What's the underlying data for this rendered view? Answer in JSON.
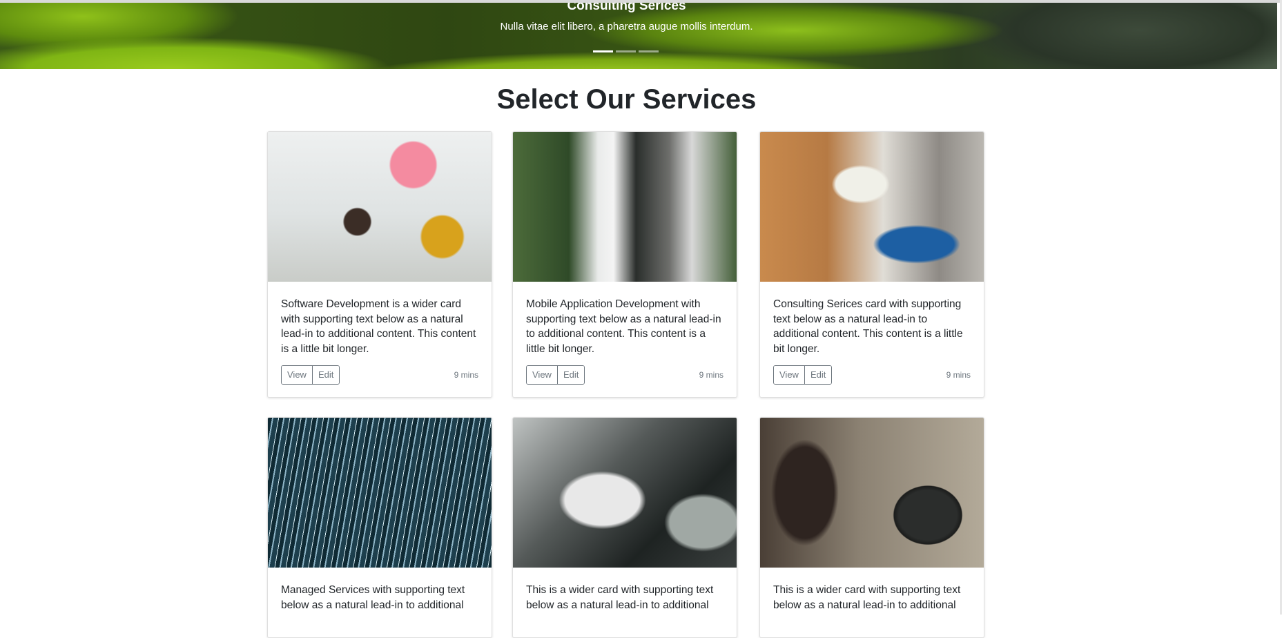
{
  "hero": {
    "title": "Consulting Serices",
    "subtitle": "Nulla vitae elit libero, a pharetra augue mollis interdum.",
    "slides": 3,
    "active_slide": 1
  },
  "heading": "Select Our Services",
  "cards": [
    {
      "text": "Software Development is a wider card with supporting text below as a natural lead-in to additional content. This content is a little bit longer.",
      "view": "View",
      "edit": "Edit",
      "time": "9 mins"
    },
    {
      "text": "Mobile Application Development with supporting text below as a natural lead-in to additional content. This content is a little bit longer.",
      "view": "View",
      "edit": "Edit",
      "time": "9 mins"
    },
    {
      "text": "Consulting Serices card with supporting text below as a natural lead-in to additional content. This content is a little bit longer.",
      "view": "View",
      "edit": "Edit",
      "time": "9 mins"
    },
    {
      "text": "Managed Services with supporting text below as a natural lead-in to additional"
    },
    {
      "text": "This is a wider card with supporting text below as a natural lead-in to additional"
    },
    {
      "text": "This is a wider card with supporting text below as a natural lead-in to additional"
    }
  ]
}
